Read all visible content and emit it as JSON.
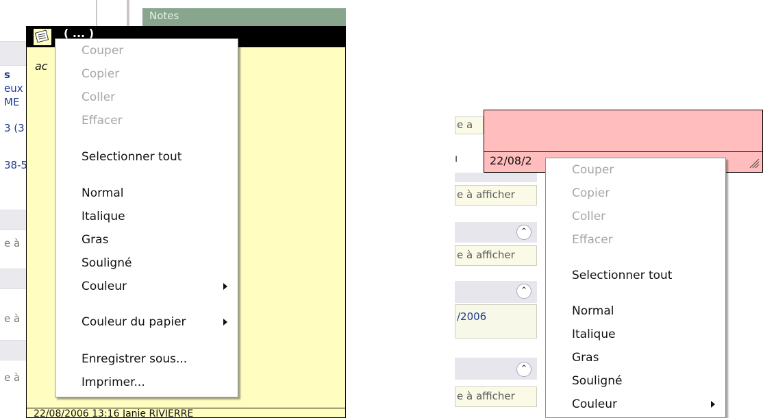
{
  "left": {
    "notes_header": "Notes",
    "sidebar": {
      "item1": "s",
      "item2": "eux",
      "item3": "ME",
      "item4": "3 (3",
      "item5": "38-5",
      "item6": "e à",
      "item7": "e à",
      "item8": "e à"
    },
    "note": {
      "title_fragment": "( ... )",
      "body_text": "ac",
      "footer_text": "22/08/2006 13:16 Janie RIVIERRE"
    },
    "context_menu": {
      "items": [
        {
          "label": "Couper",
          "enabled": false
        },
        {
          "label": "Copier",
          "enabled": false
        },
        {
          "label": "Coller",
          "enabled": false
        },
        {
          "label": "Effacer",
          "enabled": false
        },
        {
          "label": "Selectionner tout",
          "enabled": true
        },
        {
          "label": "Normal",
          "enabled": true
        },
        {
          "label": "Italique",
          "enabled": true
        },
        {
          "label": "Gras",
          "enabled": true
        },
        {
          "label": "Souligné",
          "enabled": true
        },
        {
          "label": "Couleur",
          "enabled": true,
          "submenu": true
        },
        {
          "label": "Couleur du papier",
          "enabled": true,
          "submenu": true
        },
        {
          "label": "Enregistrer sous...",
          "enabled": true
        },
        {
          "label": "Imprimer...",
          "enabled": true
        }
      ]
    }
  },
  "right": {
    "rows": {
      "r1": "e a",
      "r2": "e à afficher",
      "r3": "e à afficher",
      "r4": "/2006",
      "r5": "e à afficher"
    },
    "note": {
      "footer_text": "22/08/2"
    },
    "context_menu": {
      "items": [
        {
          "label": "Couper",
          "enabled": false
        },
        {
          "label": "Copier",
          "enabled": false
        },
        {
          "label": "Coller",
          "enabled": false
        },
        {
          "label": "Effacer",
          "enabled": false
        },
        {
          "label": "Selectionner tout",
          "enabled": true
        },
        {
          "label": "Normal",
          "enabled": true
        },
        {
          "label": "Italique",
          "enabled": true
        },
        {
          "label": "Gras",
          "enabled": true
        },
        {
          "label": "Souligné",
          "enabled": true
        },
        {
          "label": "Couleur",
          "enabled": true,
          "submenu": true
        }
      ]
    }
  },
  "colors": {
    "note_yellow": "#fffdc0",
    "note_pink": "#ffbdbd",
    "notes_header_green": "#87a68d",
    "disabled_text": "#a6a6a6"
  },
  "icons": [
    "note-icon",
    "submenu-arrow-icon",
    "collapse-chevron-icon",
    "resize-grip-icon"
  ]
}
